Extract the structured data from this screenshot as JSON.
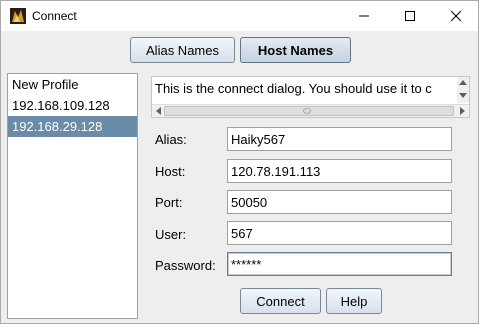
{
  "window": {
    "title": "Connect",
    "icon": "app-icon",
    "controls": {
      "minimize": "minimize-icon",
      "maximize": "maximize-icon",
      "close": "close-icon"
    }
  },
  "top_buttons": {
    "alias_label": "Alias Names",
    "host_label": "Host Names"
  },
  "profiles": [
    {
      "label": "New Profile",
      "selected": false
    },
    {
      "label": "192.168.109.128",
      "selected": false
    },
    {
      "label": "192.168.29.128",
      "selected": true
    }
  ],
  "description": "This is the connect dialog. You should use it to c",
  "form": {
    "alias_label": "Alias:",
    "alias_value": "Haiky567",
    "host_label": "Host:",
    "host_value": "120.78.191.113",
    "port_label": "Port:",
    "port_value": "50050",
    "user_label": "User:",
    "user_value": "567",
    "password_label": "Password:",
    "password_value": "******"
  },
  "bottom_buttons": {
    "connect_label": "Connect",
    "help_label": "Help"
  },
  "colors": {
    "selection": "#6a8ca8",
    "button_border": "#7a8a99",
    "window_bg": "#eeeeee"
  }
}
